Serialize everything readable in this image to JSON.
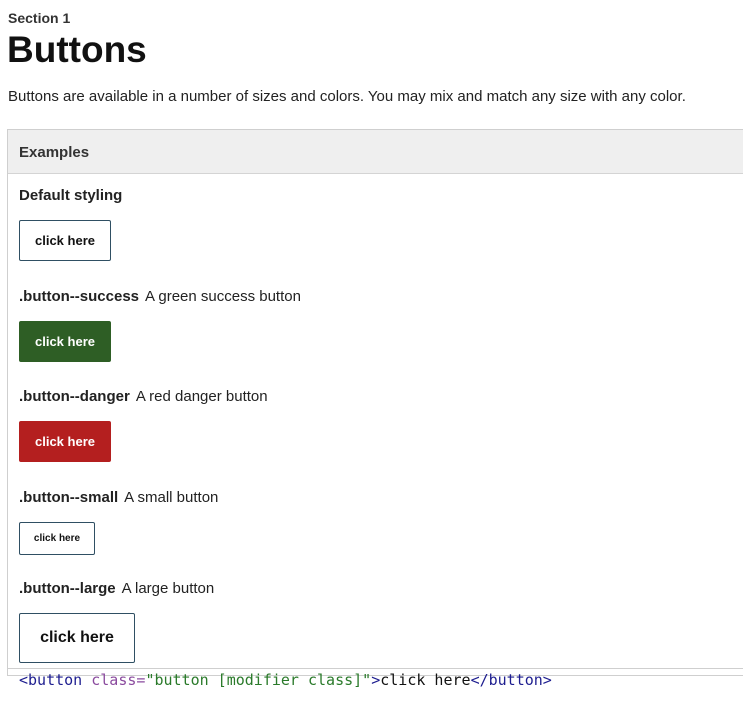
{
  "section": {
    "label": "Section 1",
    "title": "Buttons"
  },
  "intro": "Buttons are available in a number of sizes and colors. You may mix and match any size with any color.",
  "examples": {
    "header": "Examples",
    "default": {
      "heading": "Default styling",
      "button_label": "click here"
    },
    "success": {
      "class_name": ".button--success",
      "description": "A green success button",
      "button_label": "click here",
      "color": "#2e5e25"
    },
    "danger": {
      "class_name": ".button--danger",
      "description": "A red danger button",
      "button_label": "click here",
      "color": "#b41f1f"
    },
    "small": {
      "class_name": ".button--small",
      "description": "A small button",
      "button_label": "click here"
    },
    "large": {
      "class_name": ".button--large",
      "description": "A large button",
      "button_label": "click here"
    }
  },
  "code": {
    "open_tag": "<button",
    "attr_name": " class=",
    "attr_value": "\"button [modifier class]\"",
    "tag_close": ">",
    "text": "click here",
    "end_tag": "</button>"
  }
}
